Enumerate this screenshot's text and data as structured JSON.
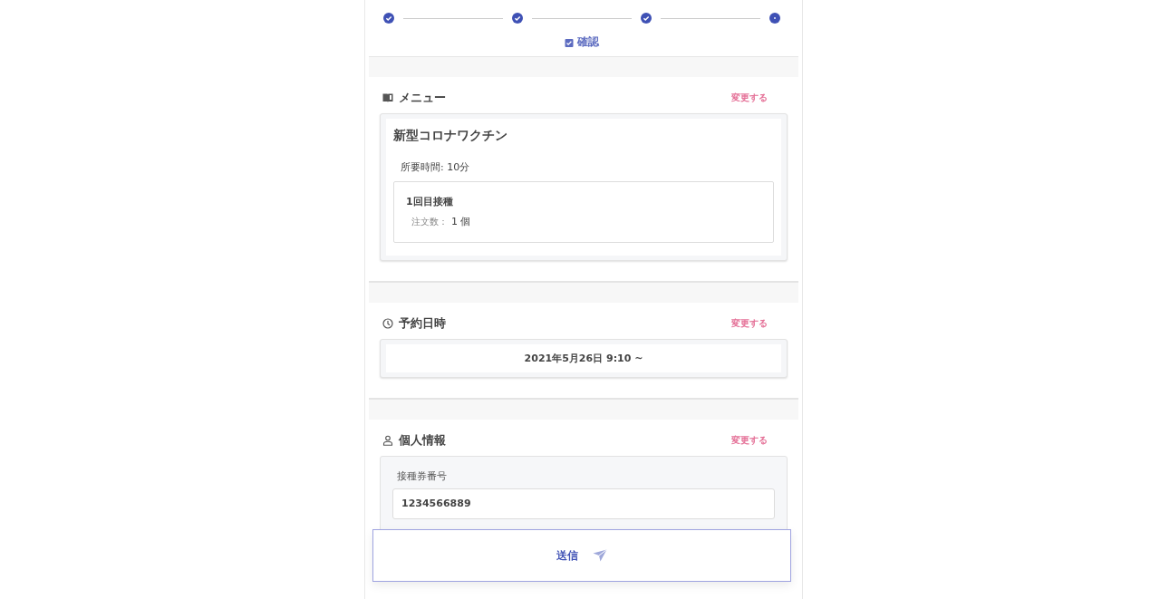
{
  "stepper": {
    "steps": [
      {
        "completed": true
      },
      {
        "completed": true
      },
      {
        "completed": true
      },
      {
        "completed": false
      }
    ],
    "current_label": "確認"
  },
  "menu_section": {
    "title": "メニュー",
    "change_link": "変更する",
    "item_name": "新型コロナワクチン",
    "duration": "所要時間: 10分",
    "option": {
      "name": "1回目接種",
      "quantity_label": "注文数：",
      "quantity": "1 個"
    }
  },
  "datetime_section": {
    "title": "予約日時",
    "change_link": "変更する",
    "datetime": "2021年5月26日 9:10 ~"
  },
  "personal_section": {
    "title": "個人情報",
    "change_link": "変更する",
    "fields": [
      {
        "label": "接種券番号",
        "value": "1234566889"
      }
    ]
  },
  "submit_button": {
    "label": "送信"
  }
}
